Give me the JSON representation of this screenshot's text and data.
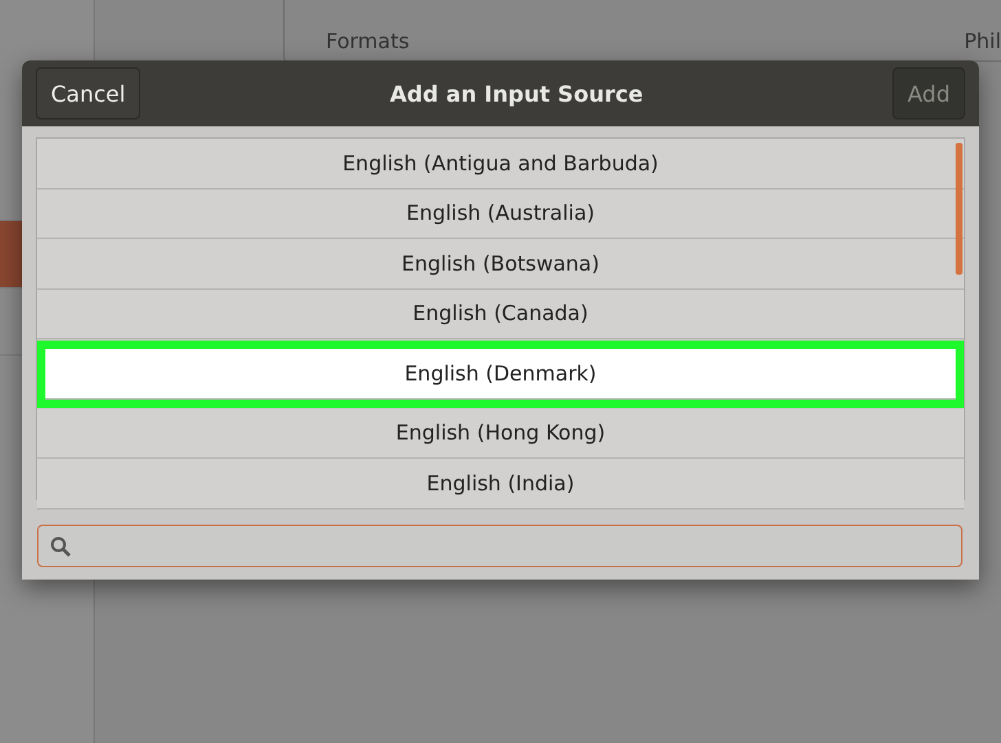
{
  "background": {
    "sidebar": {
      "items": [
        {
          "selected": false
        },
        {
          "selected": true
        },
        {
          "selected": false
        }
      ]
    },
    "card": {
      "label": "Formats",
      "value": "Phil"
    }
  },
  "dialog": {
    "title": "Add an Input Source",
    "cancel_button": "Cancel",
    "add_button": {
      "label": "Add",
      "disabled": true
    },
    "rows": [
      {
        "label": "English (Antigua and Barbuda)",
        "selected": false
      },
      {
        "label": "English (Australia)",
        "selected": false
      },
      {
        "label": "English (Botswana)",
        "selected": false
      },
      {
        "label": "English (Canada)",
        "selected": false
      },
      {
        "label": "English (Denmark)",
        "selected": true
      },
      {
        "label": "English (Hong Kong)",
        "selected": false
      },
      {
        "label": "English (India)",
        "selected": false
      }
    ]
  }
}
